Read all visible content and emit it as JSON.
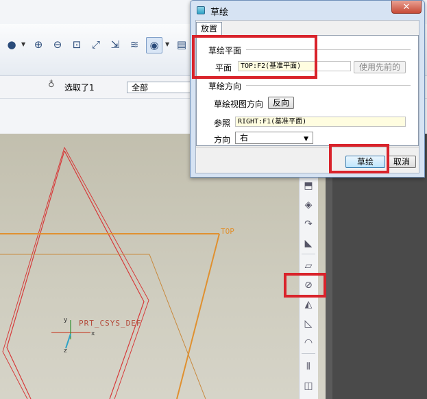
{
  "dialog": {
    "title": "草绘",
    "close_glyph": "✕",
    "tab": "放置",
    "sketch_plane": {
      "group_title": "草绘平面",
      "plane_label": "平面",
      "plane_value": "TOP:F2(基准平面)",
      "use_previous_label": "使用先前的"
    },
    "sketch_orientation": {
      "group_title": "草绘方向",
      "view_direction_label": "草绘视图方向",
      "flip_label": "反向",
      "reference_label": "参照",
      "reference_value": "RIGHT:F1(基准平面)",
      "orientation_label": "方向",
      "orientation_value": "右"
    },
    "sketch_button": "草绘",
    "cancel_button": "取消"
  },
  "filter_bar": {
    "selected_text": "选取了1",
    "filter_value": "全部"
  },
  "canvas": {
    "plane_label": "TOP",
    "csys_label": "PRT_CSYS_DEF",
    "axis_x": "x",
    "axis_y": "y",
    "axis_z": "z"
  },
  "toolbar_icons": [
    "sphere-icon",
    "zoom-in-icon",
    "zoom-out-icon",
    "zoom-fit-icon",
    "reorient-icon",
    "view-manager-icon",
    "layers-icon",
    "display-style-icon",
    "saved-views-icon"
  ],
  "vertical_toolbar_icons": [
    "extrude-icon",
    "revolve-icon",
    "sweep-icon",
    "blend-icon",
    "datum-plane-icon",
    "sketch-tool-icon",
    "hole-icon",
    "shell-icon",
    "round-icon",
    "mirror-icon",
    "pattern-icon"
  ],
  "colors": {
    "highlight": "#d9232b",
    "datum_plane": "#e0902f",
    "sketch_line": "#d63a3a"
  }
}
